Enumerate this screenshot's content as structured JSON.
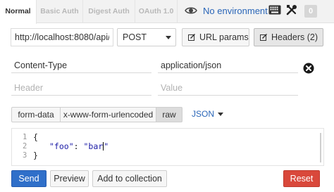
{
  "tabs": [
    "Normal",
    "Basic Auth",
    "Digest Auth",
    "OAuth 1.0"
  ],
  "environment": {
    "label": "No environment"
  },
  "badge": "0",
  "request": {
    "url": "http://localhost:8080/api/qu",
    "method": "POST",
    "url_params_label": "URL params",
    "headers_label": "Headers (2)"
  },
  "headers": {
    "rows": [
      {
        "key": "Content-Type",
        "value": "application/json"
      }
    ],
    "key_placeholder": "Header",
    "value_placeholder": "Value"
  },
  "body": {
    "types": [
      "form-data",
      "x-www-form-urlencoded",
      "raw"
    ],
    "active_type": "raw",
    "format": "JSON",
    "line_numbers": [
      "1",
      "2",
      "3"
    ],
    "lines": {
      "open": "{",
      "key": "\"foo\"",
      "colon": ": ",
      "value_before_cursor": "\"bar",
      "value_after_cursor": "\"",
      "close": "}"
    }
  },
  "actions": {
    "send": "Send",
    "preview": "Preview",
    "add_to_collection": "Add to collection",
    "reset": "Reset"
  },
  "colors": {
    "link_blue": "#2a66b8",
    "send_blue": "#2f6fc9",
    "reset_red": "#d9483b"
  }
}
